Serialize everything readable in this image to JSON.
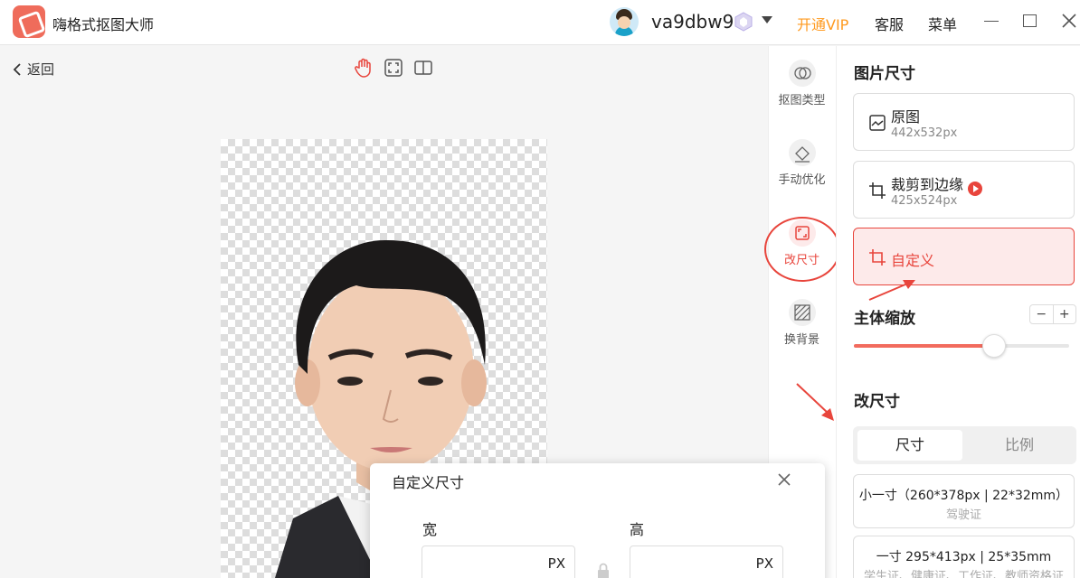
{
  "app": {
    "title": "嗨格式抠图大师"
  },
  "header": {
    "username": "va9dbw9",
    "vip_label": "开通VIP",
    "service_label": "客服",
    "menu_label": "菜单"
  },
  "canvas_bar": {
    "back_label": "返回",
    "tools": [
      "hand-icon",
      "fit-screen-icon",
      "compare-icon"
    ]
  },
  "mid_tools": [
    {
      "label": "抠图类型",
      "icon": "cutout-type-icon"
    },
    {
      "label": "手动优化",
      "icon": "eraser-icon"
    },
    {
      "label": "改尺寸",
      "icon": "resize-icon",
      "active": true
    },
    {
      "label": "换背景",
      "icon": "background-icon"
    }
  ],
  "right_panel": {
    "image_size_title": "图片尺寸",
    "options": [
      {
        "name": "原图",
        "dim": "442x532px"
      },
      {
        "name": "裁剪到边缘",
        "dim": "425x524px"
      },
      {
        "name": "自定义",
        "dim": ""
      }
    ],
    "scale_title": "主体缩放",
    "scale_minus": "−",
    "scale_plus": "+",
    "scale_value": 0.65,
    "resize_title": "改尺寸",
    "tabs": [
      "尺寸",
      "比例"
    ],
    "presets": [
      {
        "line1": "小一寸（260*378px | 22*32mm）",
        "line2": "驾驶证"
      },
      {
        "line1": "一寸 295*413px | 25*35mm",
        "line2": "学生证、健康证、工作证、教师资格证"
      }
    ]
  },
  "dialog": {
    "title": "自定义尺寸",
    "width_label": "宽",
    "height_label": "高",
    "width_unit": "PX",
    "height_unit": "PX"
  },
  "colors": {
    "accent": "#e8453c",
    "vip": "#ff9a1f",
    "slider": "#f26b5e"
  }
}
